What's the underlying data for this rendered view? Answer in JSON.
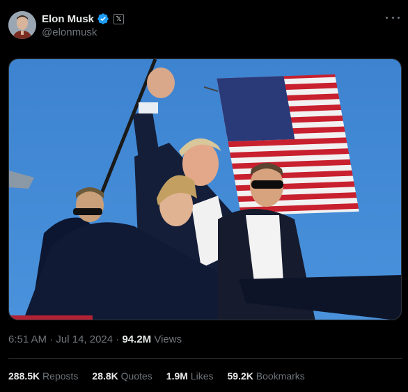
{
  "author": {
    "display_name": "Elon Musk",
    "handle": "@elonmusk",
    "affiliate_badge": "𝕏",
    "verified_icon": "verified-badge-icon"
  },
  "colors": {
    "background": "#000000",
    "text_primary": "#e7e9ea",
    "text_secondary": "#71767b",
    "verified_blue": "#1d9bf0",
    "divider": "#2f3336"
  },
  "media": {
    "type": "photo",
    "subject": "flag-and-crowd-photo"
  },
  "meta": {
    "time": "6:51 AM",
    "sep1": " · ",
    "date": "Jul 14, 2024",
    "sep2": " · ",
    "views_count": "94.2M",
    "views_label": " Views"
  },
  "stats": [
    {
      "count": "288.5K",
      "label": " Reposts"
    },
    {
      "count": "28.8K",
      "label": " Quotes"
    },
    {
      "count": "1.9M",
      "label": " Likes"
    },
    {
      "count": "59.2K",
      "label": " Bookmarks"
    }
  ]
}
